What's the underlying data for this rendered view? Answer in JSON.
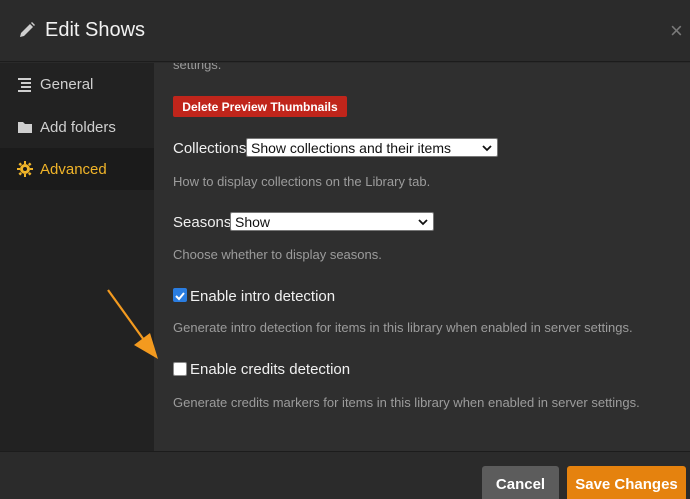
{
  "header": {
    "title": "Edit Shows",
    "close_glyph": "×"
  },
  "sidebar": {
    "items": [
      {
        "label": "General",
        "icon": "list-icon",
        "active": false
      },
      {
        "label": "Add folders",
        "icon": "folder-icon",
        "active": false
      },
      {
        "label": "Advanced",
        "icon": "gear-icon",
        "active": true
      }
    ]
  },
  "main": {
    "cut_text": "settings.",
    "delete_thumbnails_label": "Delete Preview Thumbnails",
    "collections": {
      "label": "Collections",
      "value": "Show collections and their items",
      "help": "How to display collections on the Library tab."
    },
    "seasons": {
      "label": "Seasons",
      "value": "Show",
      "help": "Choose whether to display seasons."
    },
    "intro": {
      "label": "Enable intro detection",
      "checked": true,
      "help": "Generate intro detection for items in this library when enabled in server settings."
    },
    "credits": {
      "label": "Enable credits detection",
      "checked": false,
      "help": "Generate credits markers for items in this library when enabled in server settings."
    }
  },
  "footer": {
    "cancel_label": "Cancel",
    "save_label": "Save Changes"
  },
  "colors": {
    "accent": "#f0b429",
    "danger": "#c0251b",
    "save": "#e5820e",
    "checkbox": "#2a7de1",
    "arrow": "#f39a1f"
  }
}
